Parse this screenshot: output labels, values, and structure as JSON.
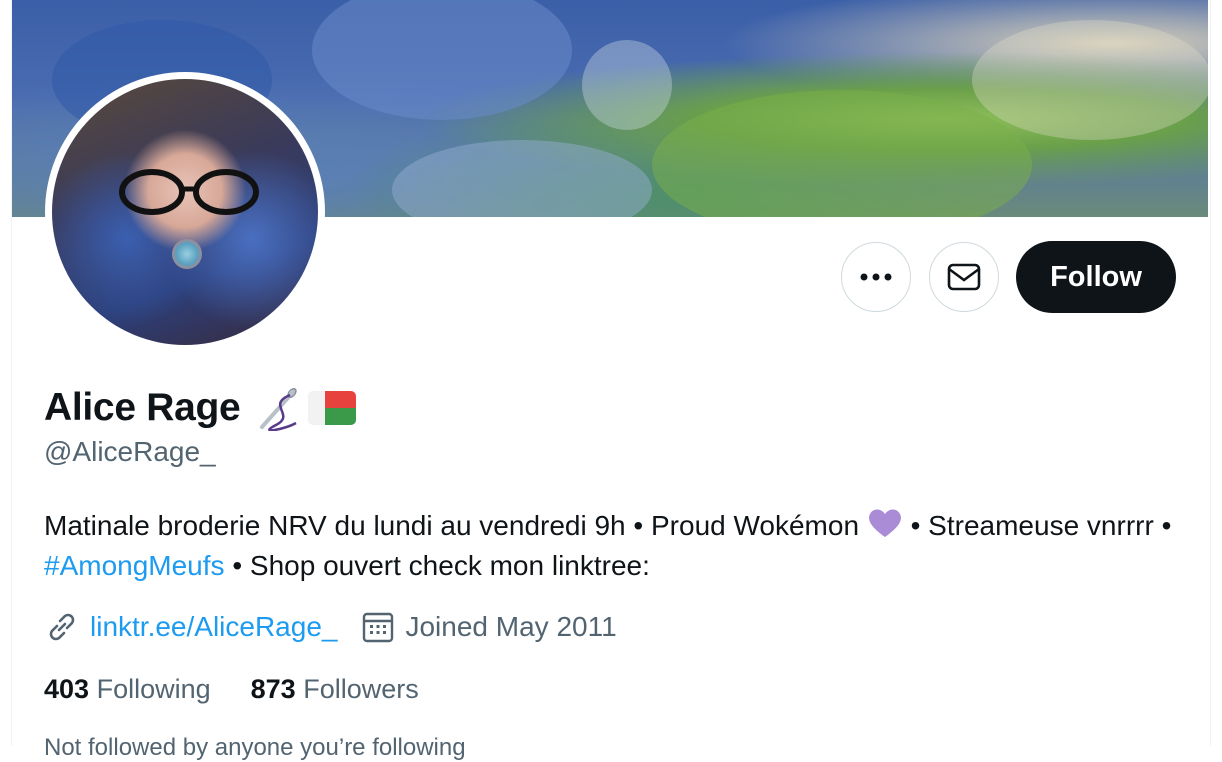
{
  "profile": {
    "name": "Alice Rage",
    "handle": "@AliceRage_",
    "bio": {
      "part1": "Matinale broderie NRV du lundi au vendredi 9h • Proud Wokémon ",
      "part2": " • Streameuse vnrrrr • ",
      "hashtag": "#AmongMeufs",
      "part3": " • Shop ouvert check mon linktree:"
    },
    "link": "linktr.ee/AliceRage_",
    "joined": "Joined May 2011",
    "following_count": "403",
    "following_label": "Following",
    "followers_count": "873",
    "followers_label": "Followers",
    "cut_off_text": "Not followed by anyone you’re following"
  },
  "actions": {
    "more_icon": "more-dots-icon",
    "message_icon": "envelope-icon",
    "follow_label": "Follow"
  },
  "colors": {
    "link_blue": "#1d9bf0",
    "follow_bg": "#0f1419",
    "secondary_text": "#536471",
    "heart_purple": "#a98bd6"
  }
}
